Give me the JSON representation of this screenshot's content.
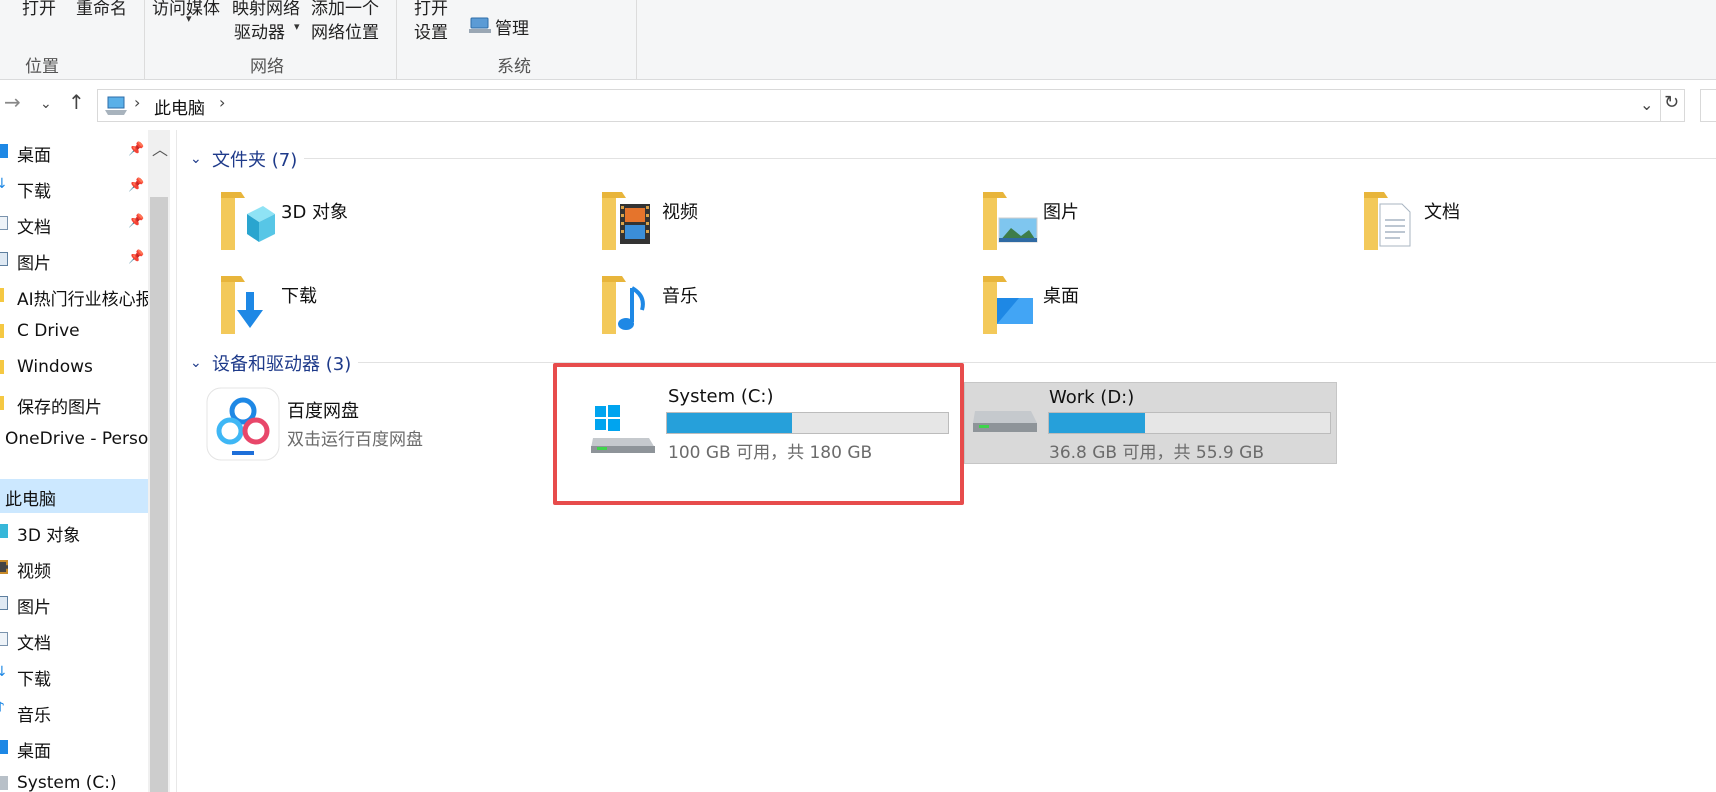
{
  "ribbon": {
    "location_group": {
      "label": "位置",
      "open": "打开",
      "rename": "重命名"
    },
    "network_group": {
      "label": "网络",
      "access_media": "访问媒体",
      "map_drive_line1": "映射网络",
      "map_drive_line2": "驱动器",
      "add_location_line1": "添加一个",
      "add_location_line2": "网络位置"
    },
    "system_group": {
      "label": "系统",
      "open_settings_line1": "打开",
      "open_settings_line2": "设置",
      "manage": "管理"
    }
  },
  "address_bar": {
    "path": "此电脑"
  },
  "sidebar": {
    "items": [
      {
        "label": "桌面",
        "pinned": true
      },
      {
        "label": "下载",
        "pinned": true
      },
      {
        "label": "文档",
        "pinned": true
      },
      {
        "label": "图片",
        "pinned": true
      },
      {
        "label": "AI热门行业核心报"
      },
      {
        "label": "C Drive"
      },
      {
        "label": "Windows"
      },
      {
        "label": "保存的图片"
      },
      {
        "label": "OneDrive - Perso"
      },
      {
        "label": "此电脑",
        "selected": true
      },
      {
        "label": "3D 对象"
      },
      {
        "label": "视频"
      },
      {
        "label": "图片"
      },
      {
        "label": "文档"
      },
      {
        "label": "下载"
      },
      {
        "label": "音乐"
      },
      {
        "label": "桌面"
      },
      {
        "label": "System (C:)"
      }
    ]
  },
  "main": {
    "folders_section": {
      "title": "文件夹 (7)"
    },
    "folders": [
      {
        "label": "3D 对象",
        "icon": "cube-folder-icon"
      },
      {
        "label": "视频",
        "icon": "film-folder-icon"
      },
      {
        "label": "图片",
        "icon": "picture-folder-icon"
      },
      {
        "label": "文档",
        "icon": "document-folder-icon"
      },
      {
        "label": "下载",
        "icon": "download-folder-icon"
      },
      {
        "label": "音乐",
        "icon": "music-folder-icon"
      },
      {
        "label": "桌面",
        "icon": "desktop-folder-icon"
      }
    ],
    "devices_section": {
      "title": "设备和驱动器 (3)"
    },
    "baidu": {
      "name": "百度网盘",
      "desc": "双击运行百度网盘"
    },
    "drives": [
      {
        "name": "System (C:)",
        "free_text": "100 GB 可用，共 180 GB",
        "used_fraction": 0.444
      },
      {
        "name": "Work (D:)",
        "free_text": "36.8 GB 可用，共 55.9 GB",
        "used_fraction": 0.342
      }
    ]
  },
  "colors": {
    "accent": "#26a0da",
    "highlight_box": "#e74c4c",
    "section_title": "#1e3a8a",
    "selected_bg": "#cce8ff"
  }
}
